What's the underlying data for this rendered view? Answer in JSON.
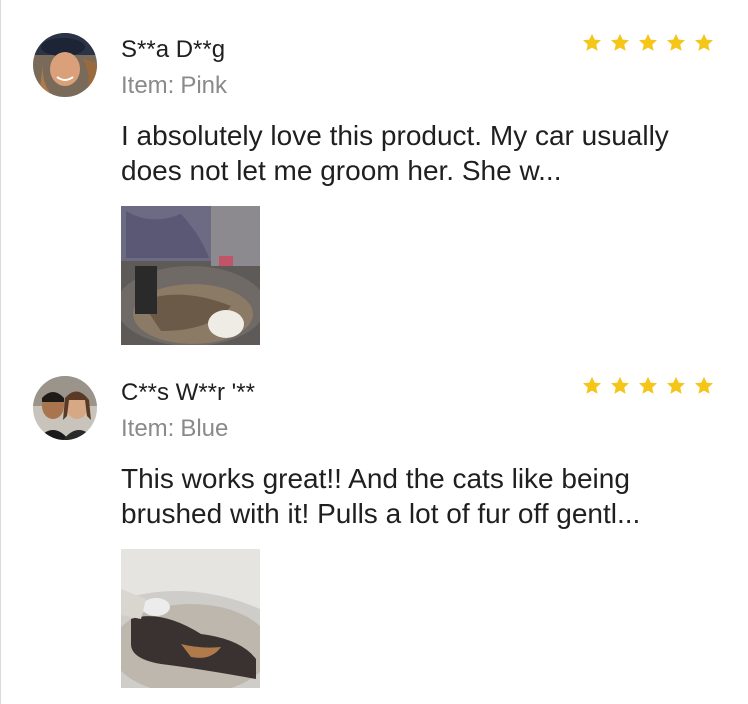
{
  "reviews": [
    {
      "reviewer": "S**a D**g",
      "item_label": "Item:",
      "item_value": "Pink",
      "rating": 5,
      "text": "I absolutely love this product. My car usually does not let me groom her. She w...",
      "avatar_icon": "reviewer-photo",
      "photo_icon": "cat-being-groomed-photo"
    },
    {
      "reviewer": "C**s W**r '**",
      "item_label": "Item:",
      "item_value": "Blue",
      "rating": 5,
      "text": "This works great!! And the cats like being brushed with it! Pulls a lot of fur off gentl...",
      "avatar_icon": "reviewer-couple-photo",
      "photo_icon": "cat-lying-photo"
    }
  ],
  "colors": {
    "star": "#f5c518",
    "item_text": "#8a8a8a",
    "body_text": "#1f1f1f"
  }
}
